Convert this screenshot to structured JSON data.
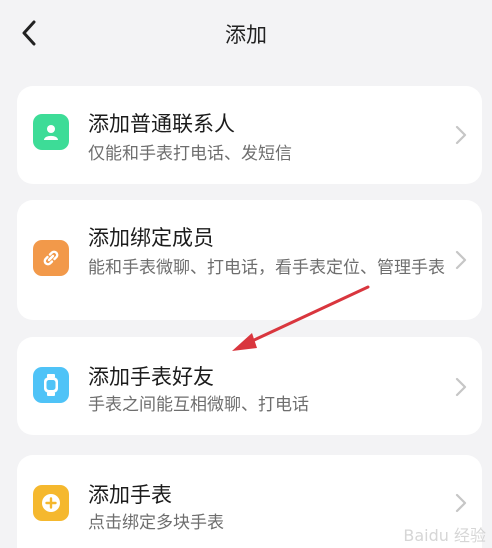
{
  "header": {
    "title": "添加"
  },
  "cards": [
    {
      "title": "添加普通联系人",
      "subtitle": "仅能和手表打电话、发短信",
      "icon": "contact-person-icon",
      "icon_color": "#3ddc97"
    },
    {
      "title": "添加绑定成员",
      "subtitle": "能和手表微聊、打电话，看手表定位、管理手表",
      "icon": "link-icon",
      "icon_color": "#f2994a"
    },
    {
      "title": "添加手表好友",
      "subtitle": "手表之间能互相微聊、打电话",
      "icon": "watch-icon",
      "icon_color": "#4fc3f7"
    },
    {
      "title": "添加手表",
      "subtitle": "点击绑定多块手表",
      "icon": "plus-circle-icon",
      "icon_color": "#f5b82e"
    }
  ],
  "annotation": {
    "arrow_color": "#d9363e"
  },
  "watermark": {
    "text": "Baidu 经验"
  }
}
